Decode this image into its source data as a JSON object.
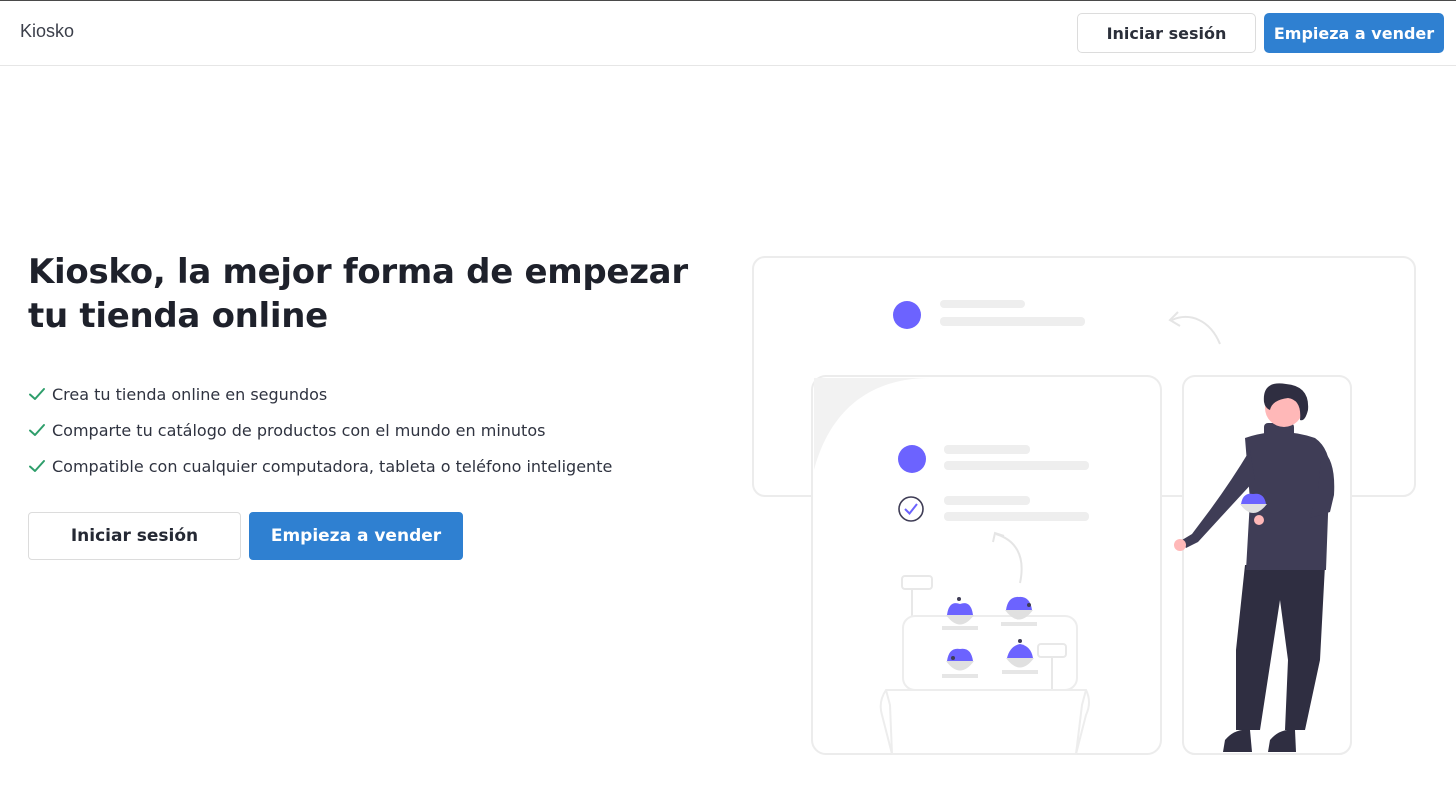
{
  "header": {
    "brand": "Kiosko",
    "login_label": "Iniciar sesión",
    "cta_label": "Empieza a vender"
  },
  "hero": {
    "title_line1": "Kiosko, la mejor forma de empezar",
    "title_line2": "tu tienda online",
    "features": [
      "Crea tu tienda online en segundos",
      "Comparte tu catálogo de productos con el mundo en minutos",
      "Compatible con cualquier computadora, tableta o teléfono inteligente"
    ],
    "login_label": "Iniciar sesión",
    "cta_label": "Empieza a vender"
  },
  "colors": {
    "primary": "#2f80d1",
    "check": "#2e9e6b",
    "illustration_accent": "#6c63ff",
    "person_dark": "#3f3d56"
  },
  "icons": {
    "feature_bullet": "check-icon",
    "illustration": "online-store-illustration"
  }
}
